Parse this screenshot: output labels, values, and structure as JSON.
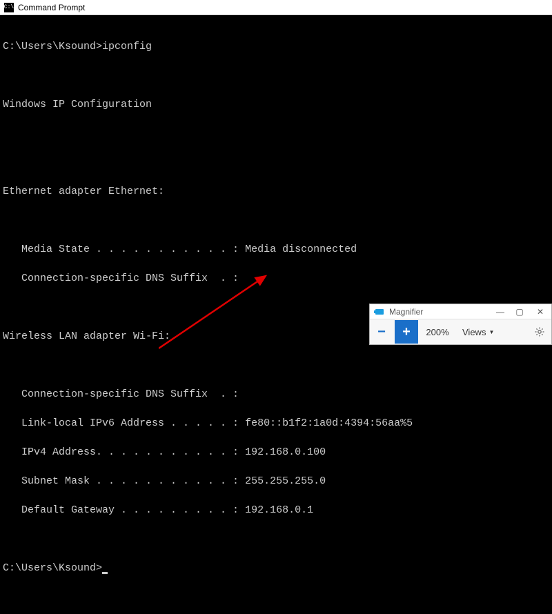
{
  "cmd": {
    "title": "Command Prompt",
    "prompt1": "C:\\Users\\Ksound>",
    "command": "ipconfig",
    "heading": "Windows IP Configuration",
    "ethernet": {
      "title": "Ethernet adapter Ethernet:",
      "media_state_label": "   Media State . . . . . . . . . . . :",
      "media_state_value": " Media disconnected",
      "dns_suffix_label": "   Connection-specific DNS Suffix  . :"
    },
    "wifi": {
      "title": "Wireless LAN adapter Wi-Fi:",
      "dns_suffix_label": "   Connection-specific DNS Suffix  . :",
      "link_local_label": "   Link-local IPv6 Address . . . . . :",
      "link_local_value": " fe80::b1f2:1a0d:4394:56aa%5",
      "ipv4_label": "   IPv4 Address. . . . . . . . . . . :",
      "ipv4_value": " 192.168.0.100",
      "subnet_label": "   Subnet Mask . . . . . . . . . . . :",
      "subnet_value": " 255.255.255.0",
      "gateway_label": "   Default Gateway . . . . . . . . . :",
      "gateway_value": " 192.168.0.1"
    },
    "prompt2": "C:\\Users\\Ksound>"
  },
  "magnifier": {
    "title": "Magnifier",
    "zoom_out": "−",
    "zoom_in": "+",
    "zoom_level": "200%",
    "views": "Views",
    "minimize": "—",
    "restore": "▢",
    "close": "✕"
  }
}
